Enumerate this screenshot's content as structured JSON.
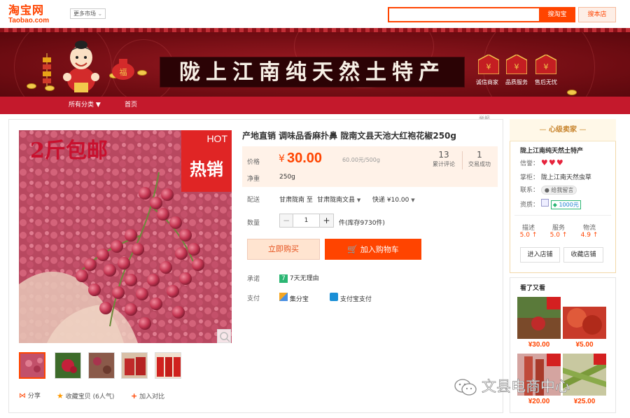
{
  "header": {
    "logo_cn": "淘宝网",
    "logo_en": "Taobao.com",
    "market_select": "更多市场",
    "search_placeholder": "",
    "search_button": "搜淘宝",
    "search_store_button": "搜本店"
  },
  "banner": {
    "title": "陇上江南纯天然土特产",
    "badges": [
      "诚信商家",
      "品质服务",
      "售后无忧"
    ]
  },
  "nav": {
    "all_categories": "所有分类 ▼",
    "home": "首页"
  },
  "report": "举报",
  "product": {
    "title": "产地直销 调味品香麻扑鼻 陇南文县天池大红袍花椒250g",
    "image_free_text": "2斤包邮",
    "hot_en": "HOT",
    "hot_cn": "热销",
    "price_label": "价格",
    "price_symbol": "¥",
    "price": "30.00",
    "unit_price": "60.00元/500g",
    "reviews_count": "13",
    "reviews_label": "累计评论",
    "trades_count": "1",
    "trades_label": "交易成功",
    "weight_label": "净重",
    "weight": "250g",
    "shipping_label": "配送",
    "shipping_from": "甘肃陇南 至",
    "shipping_to": "甘肃陇南文县",
    "shipping_method": "快递 ¥10.00",
    "quantity_label": "数量",
    "quantity": "1",
    "stock": "件(库存9730件)",
    "buy_now": "立即购买",
    "add_to_cart": "加入购物车",
    "promise_label": "承诺",
    "promise": "7天无理由",
    "payment_label": "支付",
    "payment_1": "集分宝",
    "payment_2": "支付宝支付",
    "share": "分享",
    "favorite": "收藏宝贝 (6人气)",
    "compare": "加入对比"
  },
  "seller": {
    "header": "心级卖家",
    "store_name": "陇上江南纯天然土特产",
    "credit_label": "信誉：",
    "keeper_label": "掌柜：",
    "keeper": "陇上江南天然虫草",
    "contact_label": "联系：",
    "contact": "给我留言",
    "qual_label": "资质：",
    "deposit": "1000元",
    "score_labels": [
      "描述",
      "服务",
      "物流"
    ],
    "score_values": [
      "5.0",
      "5.0",
      "4.9"
    ],
    "enter_store": "进入店铺",
    "fav_store": "收藏店铺"
  },
  "also_viewed": {
    "title": "看了又看",
    "prices": [
      "¥30.00",
      "¥5.00",
      "¥20.00",
      "¥25.00"
    ]
  },
  "watermark": "文县电商中心",
  "colors": {
    "brand": "#ff4400",
    "banner_red": "#8a0f17",
    "nav_red": "#c4192c"
  }
}
